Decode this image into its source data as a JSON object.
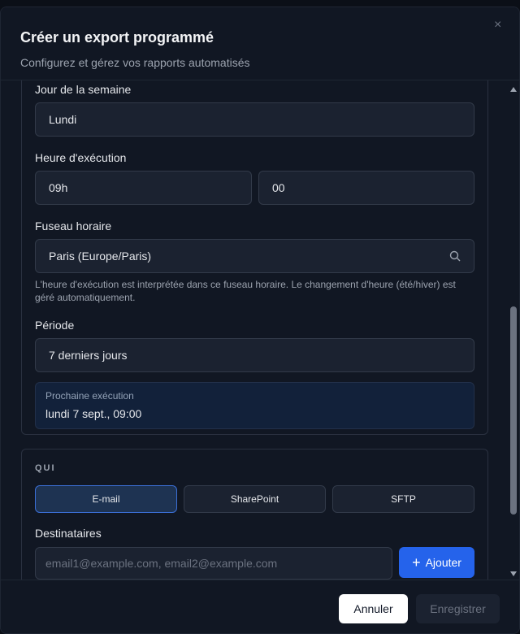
{
  "dialog": {
    "title": "Créer un export programmé",
    "subtitle": "Configurez et gérez vos rapports automatisés",
    "close_icon": "×"
  },
  "schedule": {
    "day_label": "Jour de la semaine",
    "day_value": "Lundi",
    "time_label": "Heure d'exécution",
    "hour_value": "09h",
    "minute_value": "00",
    "timezone_label": "Fuseau horaire",
    "timezone_value": "Paris (Europe/Paris)",
    "timezone_icon": "search-icon",
    "timezone_help": "L'heure d'exécution est interprétée dans ce fuseau horaire. Le changement d'heure (été/hiver) est géré automatiquement.",
    "period_label": "Période",
    "period_value": "7 derniers jours",
    "next_run_label": "Prochaine exécution",
    "next_run_value": "lundi 7 sept., 09:00"
  },
  "who": {
    "section_title": "QUI",
    "tabs": [
      {
        "label": "E-mail",
        "active": true
      },
      {
        "label": "SharePoint",
        "active": false
      },
      {
        "label": "SFTP",
        "active": false
      }
    ],
    "recipients_label": "Destinataires",
    "recipients_placeholder": "email1@example.com, email2@example.com",
    "add_button": "Ajouter"
  },
  "footer": {
    "cancel": "Annuler",
    "save": "Enregistrer"
  },
  "colors": {
    "accent": "#2563eb",
    "background": "#111723"
  }
}
